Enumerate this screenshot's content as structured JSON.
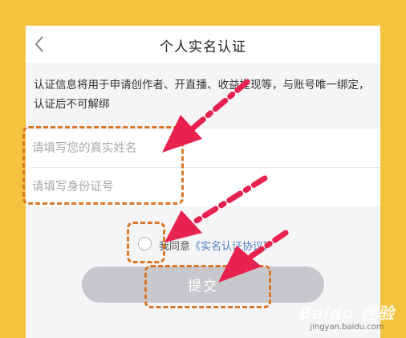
{
  "header": {
    "title": "个人实名认证"
  },
  "notice": "认证信息将用于申请创作者、开直播、收益提现等，与账号唯一绑定，认证后不可解绑",
  "form": {
    "name_placeholder": "请填写您的真实姓名",
    "id_placeholder": "请填写身份证号"
  },
  "agreement": {
    "prefix": "我同意",
    "link": "《实名认证协议》"
  },
  "submit_label": "提交",
  "watermark": {
    "main": "Baidu 经验",
    "sub": "jingyan.baidu.com"
  },
  "colors": {
    "background": "#f2c33f",
    "annotation_box": "#d9772a",
    "annotation_arrow": "#e8224f",
    "link": "#4b7fc1",
    "button_disabled": "#c8c8cc"
  },
  "icons": [
    "back-chevron-icon",
    "radio-unchecked-icon"
  ]
}
